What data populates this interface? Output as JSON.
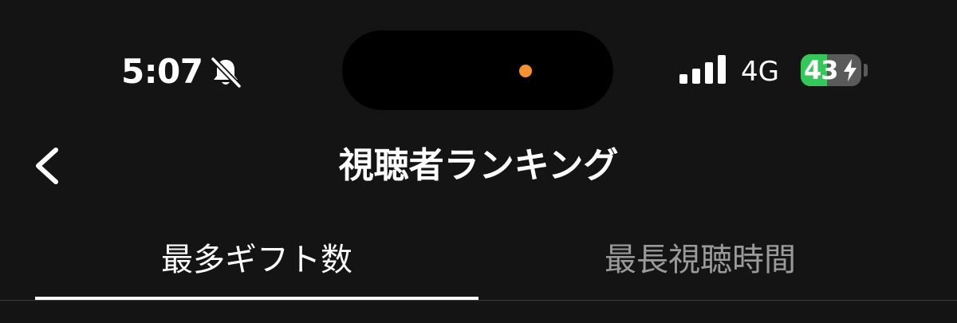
{
  "status_bar": {
    "time": "5:07",
    "silent_icon": "bell-slash-icon",
    "network": "4G",
    "battery_level": "43",
    "battery_percent": 43,
    "battery_color": "#34c759",
    "camera_dot_color": "#f7902e"
  },
  "nav": {
    "back_icon": "chevron-left-icon",
    "title": "視聴者ランキング"
  },
  "tabs": [
    {
      "label": "最多ギフト数",
      "active": true
    },
    {
      "label": "最長視聴時間",
      "active": false
    }
  ],
  "colors": {
    "background": "#141414",
    "active_tab": "#ffffff",
    "inactive_tab": "#9a9a9a"
  }
}
